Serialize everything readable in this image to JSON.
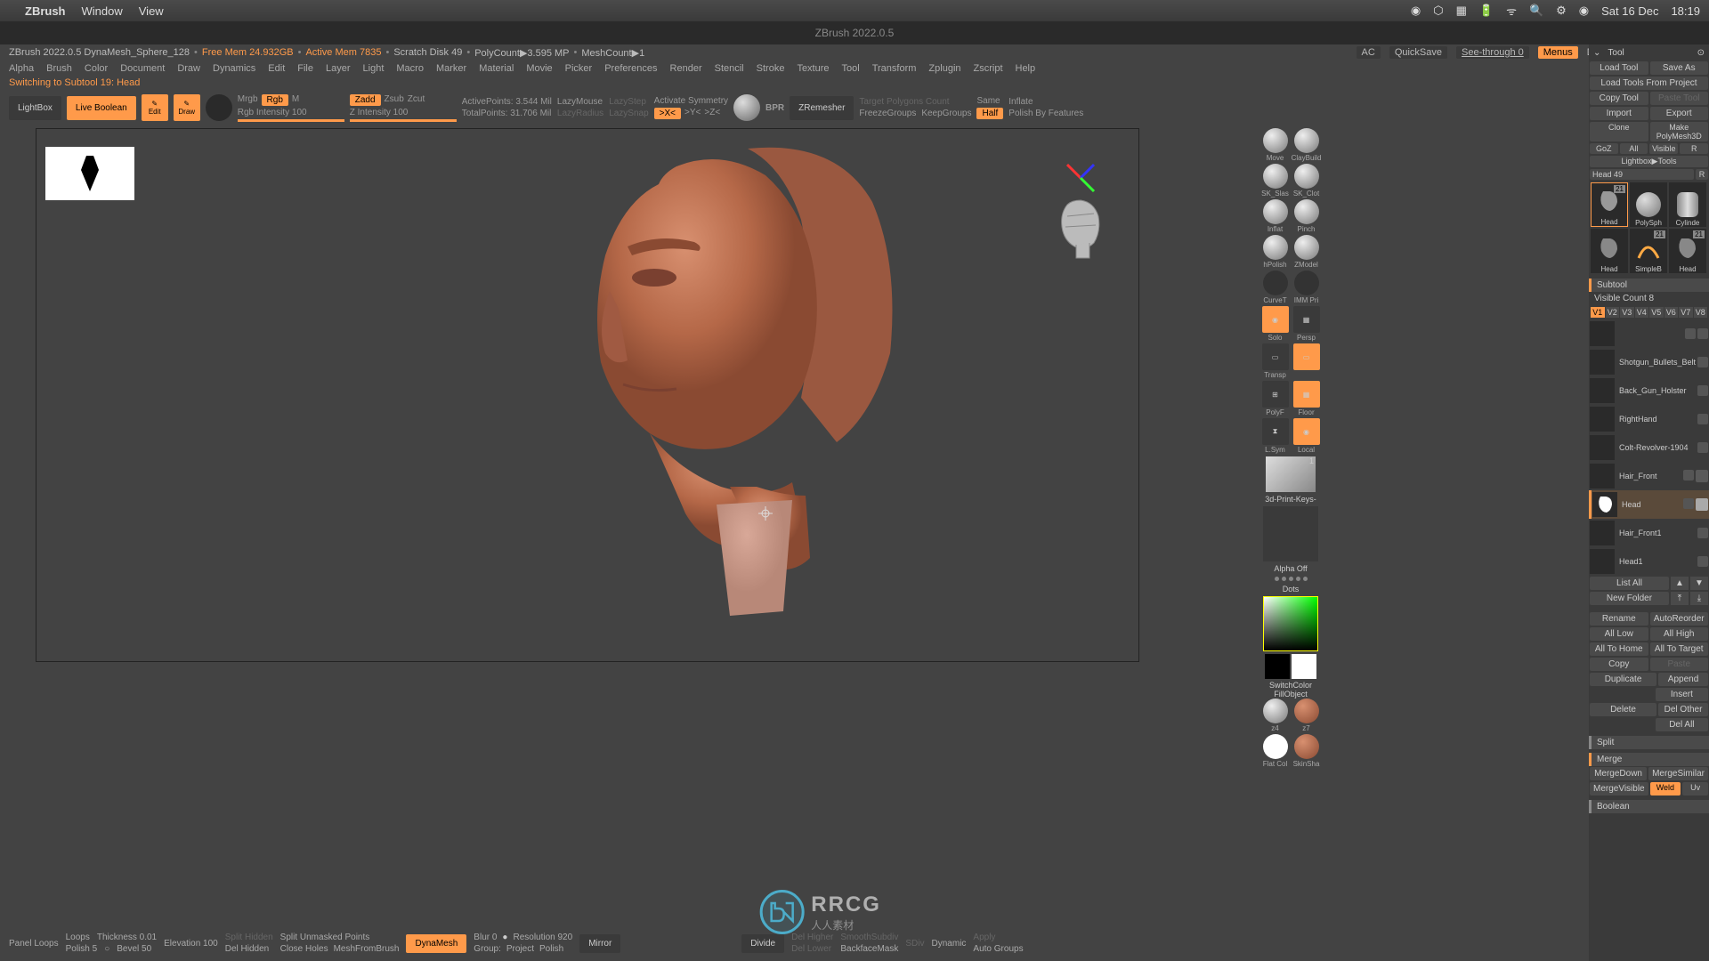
{
  "macos": {
    "app": "ZBrush",
    "menus": [
      "Window",
      "View"
    ],
    "date": "Sat 16 Dec",
    "time": "18:19"
  },
  "titlebar": "ZBrush 2022.0.5",
  "infobar": {
    "version": "ZBrush 2022.0.5 DynaMesh_Sphere_128",
    "freemem": "Free Mem 24.932GB",
    "activemem": "Active Mem 7835",
    "scratch": "Scratch Disk 49",
    "polycount": "PolyCount▶3.595 MP",
    "meshcount": "MeshCount▶1",
    "ac": "AC",
    "quicksave": "QuickSave",
    "seethrough": "See-through  0",
    "menus": "Menus",
    "defaultzscript": "DefaultZScript"
  },
  "menubar": [
    "Alpha",
    "Brush",
    "Color",
    "Document",
    "Draw",
    "Dynamics",
    "Edit",
    "File",
    "Layer",
    "Light",
    "Macro",
    "Marker",
    "Material",
    "Movie",
    "Picker",
    "Preferences",
    "Render",
    "Stencil",
    "Stroke",
    "Texture",
    "Tool",
    "Transform",
    "Zplugin",
    "Zscript",
    "Help"
  ],
  "switchbar": "Switching to Subtool 19:   Head",
  "toolbar": {
    "lightbox": "LightBox",
    "liveboolean": "Live Boolean",
    "edit": "Edit",
    "draw": "Draw",
    "mrgb": "Mrgb",
    "rgb": "Rgb",
    "m": "M",
    "rgbintensity": "Rgb Intensity 100",
    "zadd": "Zadd",
    "zsub": "Zsub",
    "zcut": "Zcut",
    "zintensity": "Z Intensity 100",
    "activepoints": "ActivePoints: 3.544 Mil",
    "totalpoints": "TotalPoints: 31.706 Mil",
    "lazymouse": "LazyMouse",
    "lazyradius": "LazyRadius",
    "lazystep": "LazyStep",
    "lazysnap": "LazySnap",
    "activatesym": "Activate Symmetry",
    "bpr": "BPR",
    "zremesher": "ZRemesher",
    "targetpoly": "Target Polygons Count",
    "same": "Same",
    "freezegroups": "FreezeGroups",
    "keepgroups": "KeepGroups",
    "half": "Half",
    "inflate": "Inflate",
    "polishby": "Polish By Features"
  },
  "brushpanel": {
    "move": "Move",
    "claybuild": "ClayBuild",
    "skslash": "SK_Slas",
    "skclot": "SK_Clot",
    "inflat": "Inflat",
    "pinch": "Pinch",
    "hpolish": "hPolish",
    "zmodel": "ZModel",
    "curvet": "CurveT",
    "immpri": "IMM Pri",
    "solo": "Solo",
    "persp": "Persp",
    "transp": "Transp",
    "polyf": "PolyF",
    "floor": "Floor",
    "lsym": "L.Sym",
    "local": "Local",
    "printkeys": "3d-Print-Keys-",
    "alphaoff": "Alpha Off",
    "dots": "Dots",
    "switchcolor": "SwitchColor",
    "fillobject": "FillObject",
    "z4": "z4",
    "z7": "z7",
    "flatcol": "Flat Col",
    "skinsha": "SkinSha"
  },
  "toolpanel": {
    "header": "Tool",
    "loadtool": "Load Tool",
    "saveas": "Save As",
    "loadtoolsfrom": "Load Tools From Project",
    "copytool": "Copy Tool",
    "pastetool": "Paste Tool",
    "import": "Import",
    "export": "Export",
    "clone": "Clone",
    "makepolymesh": "Make PolyMesh3D",
    "goz": "GoZ",
    "all": "All",
    "visible": "Visible",
    "r": "R",
    "lightboxtools": "Lightbox▶Tools",
    "headcount": "Head  49",
    "thumbs": [
      {
        "label": "Head",
        "badge": "21",
        "selected": true
      },
      {
        "label": "PolySph",
        "badge": ""
      },
      {
        "label": "Cylinde",
        "badge": ""
      },
      {
        "label": "Head",
        "badge": ""
      },
      {
        "label": "SimpleB",
        "badge": "21"
      },
      {
        "label": "Head",
        "badge": "21"
      }
    ],
    "subtool": "Subtool",
    "visiblecount": "Visible Count 8",
    "visbuttons": [
      "V1",
      "V2",
      "V3",
      "V4",
      "V5",
      "V6",
      "V7",
      "V8"
    ],
    "subtools": [
      {
        "name": "",
        "selected": false
      },
      {
        "name": "Shotgun_Bullets_Belt",
        "selected": false
      },
      {
        "name": "Back_Gun_Holster",
        "selected": false
      },
      {
        "name": "RightHand",
        "selected": false
      },
      {
        "name": "Colt-Revolver-1904",
        "selected": false
      },
      {
        "name": "Hair_Front",
        "selected": false
      },
      {
        "name": "Head",
        "selected": true
      },
      {
        "name": "Hair_Front1",
        "selected": false
      },
      {
        "name": "Head1",
        "selected": false
      }
    ],
    "listall": "List All",
    "newfolder": "New Folder",
    "rename": "Rename",
    "autoreorder": "AutoReorder",
    "alllow": "All Low",
    "allhigh": "All High",
    "alltohome": "All To Home",
    "alltotarget": "All To Target",
    "copy": "Copy",
    "paste": "Paste",
    "duplicate": "Duplicate",
    "append": "Append",
    "insert": "Insert",
    "delete": "Delete",
    "delother": "Del Other",
    "delall": "Del All",
    "split": "Split",
    "merge": "Merge",
    "mergedown": "MergeDown",
    "mergesimilar": "MergeSimilar",
    "mergevisible": "MergeVisible",
    "weld": "Weld",
    "uv": "Uv",
    "boolean": "Boolean"
  },
  "bottombar": {
    "panelloops": "Panel Loops",
    "loops": "Loops",
    "thickness": "Thickness 0.01",
    "polish": "Polish 5",
    "bevel": "Bevel 50",
    "elevation": "Elevation 100",
    "splithidden": "Split Hidden",
    "delhidden": "Del Hidden",
    "splitunmasked": "Split Unmasked Points",
    "closeholes": "Close Holes",
    "meshfrombrush": "MeshFromBrush",
    "dynamesh": "DynaMesh",
    "blur": "Blur 0",
    "resolution": "Resolution 920",
    "group": "Group:",
    "project": "Project",
    "polish2": "Polish",
    "mirror": "Mirror",
    "divide": "Divide",
    "delhigher": "Del Higher",
    "dellower": "Del Lower",
    "backfacemask": "BackfaceMask",
    "smoothsubdiv": "SmoothSubdiv",
    "sdiv": "SDiv",
    "dynamic": "Dynamic",
    "apply": "Apply",
    "autogroups": "Auto Groups"
  },
  "watermark": {
    "text": "RRCG",
    "sub": "人人素材"
  }
}
